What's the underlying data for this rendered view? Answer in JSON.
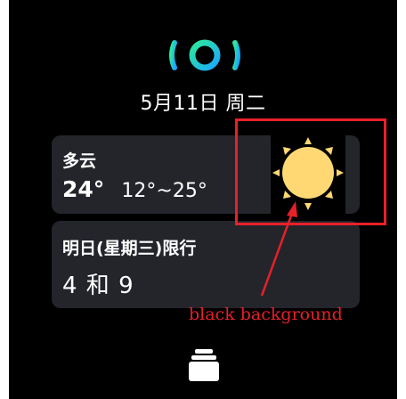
{
  "header": {
    "date": "5月11日 周二"
  },
  "weather": {
    "condition": "多云",
    "temp_now": "24°",
    "temp_range": "12°~25°",
    "icon": "sun-icon"
  },
  "traffic_limit": {
    "title": "明日(星期三)限行",
    "numbers": "4 和 9"
  },
  "annotation": {
    "text": "black background",
    "color": "#e8202a"
  },
  "colors": {
    "card": "#23252b",
    "sun": "#ffd873",
    "logo_green": "#2ee89a",
    "logo_blue": "#1aa8ff"
  }
}
